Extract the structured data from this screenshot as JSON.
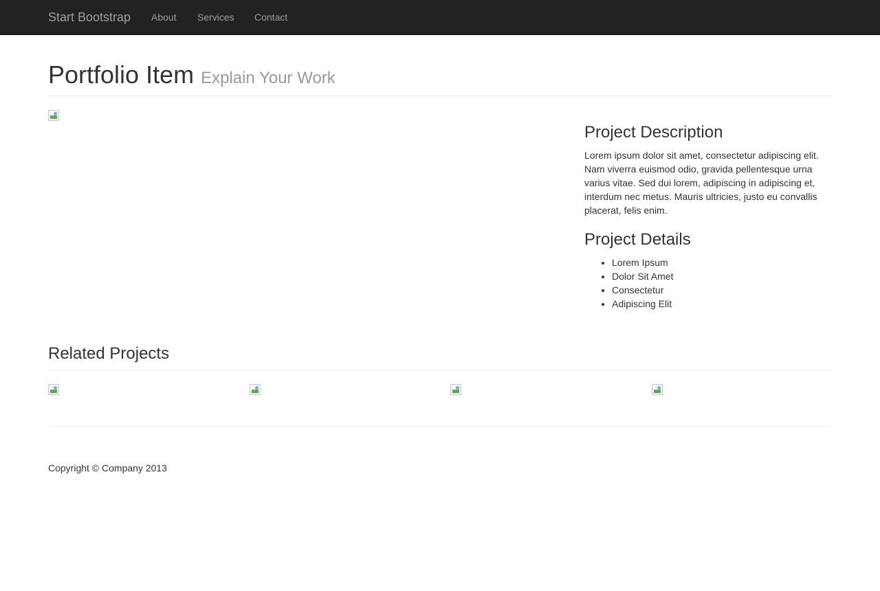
{
  "navbar": {
    "brand": "Start Bootstrap",
    "links": [
      "About",
      "Services",
      "Contact"
    ]
  },
  "header": {
    "title": "Portfolio Item",
    "subtitle": "Explain Your Work"
  },
  "project": {
    "description_heading": "Project Description",
    "description_text": "Lorem ipsum dolor sit amet, consectetur adipiscing elit. Nam viverra euismod odio, gravida pellentesque urna varius vitae. Sed dui lorem, adipiscing in adipiscing et, interdum nec metus. Mauris ultricies, justo eu convallis placerat, felis enim.",
    "details_heading": "Project Details",
    "details": [
      "Lorem Ipsum",
      "Dolor Sit Amet",
      "Consectetur",
      "Adipiscing Elit"
    ]
  },
  "related": {
    "heading": "Related Projects"
  },
  "footer": {
    "copyright": "Copyright © Company 2013"
  }
}
